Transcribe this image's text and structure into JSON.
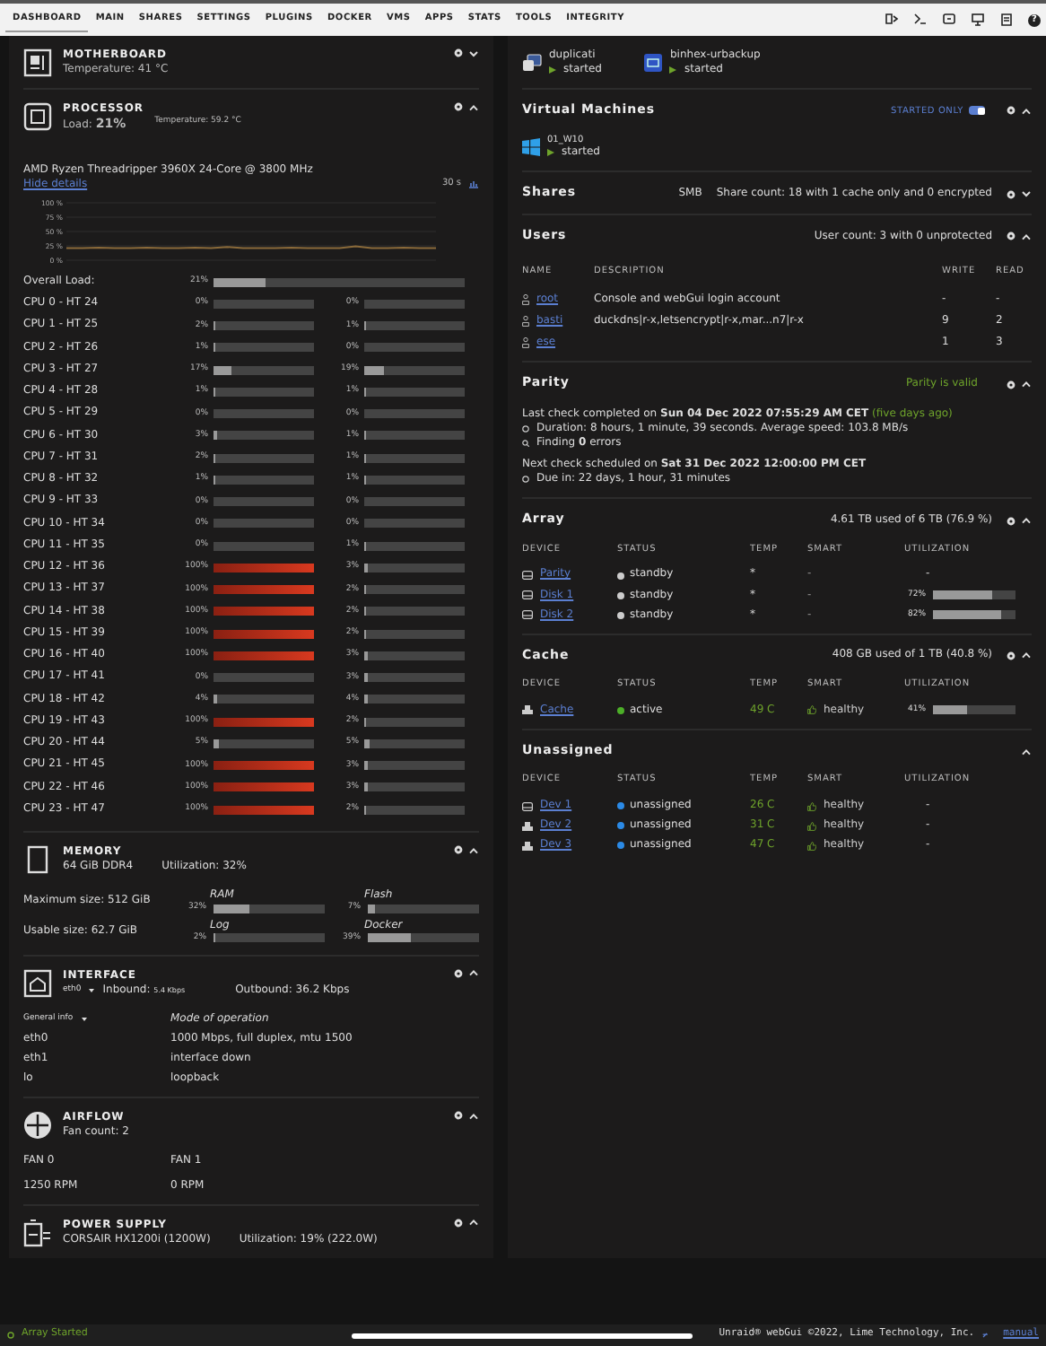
{
  "nav": {
    "tabs": [
      {
        "label": "DASHBOARD",
        "selected": true
      },
      {
        "label": "MAIN",
        "selected": false
      },
      {
        "label": "SHARES",
        "selected": false
      },
      {
        "label": "SETTINGS",
        "selected": false
      },
      {
        "label": "PLUGINS",
        "selected": false
      },
      {
        "label": "DOCKER",
        "selected": false
      },
      {
        "label": "VMS",
        "selected": false
      },
      {
        "label": "APPS",
        "selected": false
      },
      {
        "label": "STATS",
        "selected": false
      },
      {
        "label": "TOOLS",
        "selected": false
      },
      {
        "label": "INTEGRITY",
        "selected": false
      }
    ],
    "help": "?"
  },
  "motherboard": {
    "title": "MOTHERBOARD",
    "temperature": "Temperature: 41 °C",
    "expanded": false
  },
  "processor": {
    "title": "PROCESSOR",
    "load_label": "Load:",
    "load": "21%",
    "temperature": "Temperature: 59.2 °C",
    "expanded": true,
    "cpu_name": "AMD Ryzen Threadripper 3960X 24-Core @ 3800 MHz",
    "details_link": "Hide details",
    "interval": "30 s",
    "chart_data": {
      "type": "line",
      "ylim": [
        0,
        100
      ],
      "yticks": [
        {
          "value": 100,
          "label": "100 %"
        },
        {
          "value": 75,
          "label": "75 %"
        },
        {
          "value": 50,
          "label": "50 %"
        },
        {
          "value": 25,
          "label": "25 %"
        },
        {
          "value": 0,
          "label": "0 %"
        }
      ],
      "grid": true,
      "series": [
        {
          "color": "#8a6a3a",
          "values": [
            21,
            21,
            22,
            21,
            21,
            22,
            21,
            21,
            22,
            21,
            23,
            21,
            21,
            21,
            22,
            21,
            21,
            21,
            24,
            21,
            21,
            22,
            21,
            21
          ]
        }
      ]
    },
    "overall": {
      "label": "Overall Load:",
      "reading": "21%",
      "level": 0.21
    },
    "cpus": [
      {
        "label": "CPU 0 - HT 24",
        "a": {
          "reading": "0%",
          "level": 0
        },
        "b": {
          "reading": "0%",
          "level": 0
        }
      },
      {
        "label": "CPU 1 - HT 25",
        "a": {
          "reading": "2%",
          "level": 0.02
        },
        "b": {
          "reading": "1%",
          "level": 0.01
        }
      },
      {
        "label": "CPU 2 - HT 26",
        "a": {
          "reading": "1%",
          "level": 0.01
        },
        "b": {
          "reading": "0%",
          "level": 0
        }
      },
      {
        "label": "CPU 3 - HT 27",
        "a": {
          "reading": "17%",
          "level": 0.17
        },
        "b": {
          "reading": "19%",
          "level": 0.19
        }
      },
      {
        "label": "CPU 4 - HT 28",
        "a": {
          "reading": "1%",
          "level": 0.01
        },
        "b": {
          "reading": "1%",
          "level": 0.01
        }
      },
      {
        "label": "CPU 5 - HT 29",
        "a": {
          "reading": "0%",
          "level": 0
        },
        "b": {
          "reading": "0%",
          "level": 0
        }
      },
      {
        "label": "CPU 6 - HT 30",
        "a": {
          "reading": "3%",
          "level": 0.03
        },
        "b": {
          "reading": "1%",
          "level": 0.01
        }
      },
      {
        "label": "CPU 7 - HT 31",
        "a": {
          "reading": "2%",
          "level": 0.02
        },
        "b": {
          "reading": "1%",
          "level": 0.01
        }
      },
      {
        "label": "CPU 8 - HT 32",
        "a": {
          "reading": "1%",
          "level": 0.01
        },
        "b": {
          "reading": "1%",
          "level": 0.01
        }
      },
      {
        "label": "CPU 9 - HT 33",
        "a": {
          "reading": "0%",
          "level": 0
        },
        "b": {
          "reading": "0%",
          "level": 0
        }
      },
      {
        "label": "CPU 10 - HT 34",
        "a": {
          "reading": "0%",
          "level": 0
        },
        "b": {
          "reading": "0%",
          "level": 0
        }
      },
      {
        "label": "CPU 11 - HT 35",
        "a": {
          "reading": "0%",
          "level": 0
        },
        "b": {
          "reading": "1%",
          "level": 0.01
        }
      },
      {
        "label": "CPU 12 - HT 36",
        "a": {
          "reading": "100%",
          "level": 1
        },
        "b": {
          "reading": "3%",
          "level": 0.03
        }
      },
      {
        "label": "CPU 13 - HT 37",
        "a": {
          "reading": "100%",
          "level": 1
        },
        "b": {
          "reading": "2%",
          "level": 0.02
        }
      },
      {
        "label": "CPU 14 - HT 38",
        "a": {
          "reading": "100%",
          "level": 1
        },
        "b": {
          "reading": "2%",
          "level": 0.02
        }
      },
      {
        "label": "CPU 15 - HT 39",
        "a": {
          "reading": "100%",
          "level": 1
        },
        "b": {
          "reading": "2%",
          "level": 0.02
        }
      },
      {
        "label": "CPU 16 - HT 40",
        "a": {
          "reading": "100%",
          "level": 1
        },
        "b": {
          "reading": "3%",
          "level": 0.03
        }
      },
      {
        "label": "CPU 17 - HT 41",
        "a": {
          "reading": "0%",
          "level": 0
        },
        "b": {
          "reading": "3%",
          "level": 0.03
        }
      },
      {
        "label": "CPU 18 - HT 42",
        "a": {
          "reading": "4%",
          "level": 0.04
        },
        "b": {
          "reading": "4%",
          "level": 0.04
        }
      },
      {
        "label": "CPU 19 - HT 43",
        "a": {
          "reading": "100%",
          "level": 1
        },
        "b": {
          "reading": "2%",
          "level": 0.02
        }
      },
      {
        "label": "CPU 20 - HT 44",
        "a": {
          "reading": "5%",
          "level": 0.05
        },
        "b": {
          "reading": "5%",
          "level": 0.05
        }
      },
      {
        "label": "CPU 21 - HT 45",
        "a": {
          "reading": "100%",
          "level": 1
        },
        "b": {
          "reading": "3%",
          "level": 0.03
        }
      },
      {
        "label": "CPU 22 - HT 46",
        "a": {
          "reading": "100%",
          "level": 1
        },
        "b": {
          "reading": "3%",
          "level": 0.03
        }
      },
      {
        "label": "CPU 23 - HT 47",
        "a": {
          "reading": "100%",
          "level": 1
        },
        "b": {
          "reading": "2%",
          "level": 0.02
        }
      }
    ]
  },
  "memory": {
    "title": "MEMORY",
    "details": "64 GiB DDR4",
    "utilization": "Utilization: 32%",
    "expanded": true,
    "sizes": [
      "Maximum size: 512 GiB",
      "Usable size: 62.7 GiB"
    ],
    "bars": [
      {
        "name": "RAM",
        "reading": "32%",
        "level": 0.32
      },
      {
        "name": "Flash",
        "reading": "7%",
        "level": 0.07
      },
      {
        "name": "Log",
        "reading": "2%",
        "level": 0.02
      },
      {
        "name": "Docker",
        "reading": "39%",
        "level": 0.39
      }
    ]
  },
  "interface": {
    "title": "INTERFACE",
    "expanded": true,
    "port": "eth0",
    "inbound_label": "Inbound:",
    "inbound": "5.4 Kbps",
    "outbound": "Outbound: 36.2 Kbps",
    "info_select": "General info",
    "heading": "Mode of operation",
    "rows": [
      {
        "name": "eth0",
        "mode": "1000 Mbps, full duplex, mtu 1500"
      },
      {
        "name": "eth1",
        "mode": "interface down"
      },
      {
        "name": "lo",
        "mode": "loopback"
      }
    ]
  },
  "airflow": {
    "title": "AIRFLOW",
    "expanded": true,
    "subtitle": "Fan count: 2",
    "fans": [
      {
        "name": "FAN 0",
        "speed": "1250 RPM"
      },
      {
        "name": "FAN 1",
        "speed": "0 RPM"
      }
    ]
  },
  "power": {
    "title": "POWER SUPPLY",
    "expanded": true,
    "model": "CORSAIR HX1200i (1200W)",
    "utilization": "Utilization: 19% (222.0W)"
  },
  "docker": [
    {
      "name": "duplicati",
      "status": "started"
    },
    {
      "name": "binhex-urbackup",
      "status": "started"
    }
  ],
  "vms": {
    "title": "Virtual Machines",
    "filter": "STARTED ONLY",
    "filter_on": true,
    "expanded": true,
    "items": [
      {
        "name": "01_W10",
        "status": "started"
      }
    ]
  },
  "shares": {
    "title": "Shares",
    "protocol": "SMB",
    "summary": "Share count: 18 with 1 cache only and 0 encrypted",
    "expanded": false
  },
  "users": {
    "title": "Users",
    "summary": "User count: 3 with 0 unprotected",
    "expanded": true,
    "columns": [
      "NAME",
      "DESCRIPTION",
      "WRITE",
      "READ"
    ],
    "rows": [
      {
        "name": "root",
        "description": "Console and webGui login account",
        "write": "-",
        "read": "-"
      },
      {
        "name": "basti",
        "description": "duckdns|r-x,letsencrypt|r-x,mar...n7|r-x",
        "write": "9",
        "read": "2"
      },
      {
        "name": "ese",
        "description": "",
        "write": "1",
        "read": "3"
      }
    ]
  },
  "parity": {
    "title": "Parity",
    "status": "Parity is valid",
    "expanded": true,
    "last": "Last check completed on **Sun 04 Dec 2022 07:55:29 AM CET**",
    "ago": "(five days ago)",
    "duration": "Duration: 8 hours, 1 minute, 39 seconds. Average speed: 103.8 MB/s",
    "finding": "Finding **0** errors",
    "next": "Next check scheduled on **Sat 31 Dec 2022 12:00:00 PM CET**",
    "due": "Due in: 22 days, 1 hour, 31 minutes"
  },
  "disks": [
    {
      "title": "Array",
      "summary": "4.61 TB used of 6 TB (76.9 %)",
      "settings": true,
      "expanded": true,
      "columns": [
        "DEVICE",
        "STATUS",
        "TEMP",
        "SMART",
        "UTILIZATION"
      ],
      "rows": [
        {
          "device": "Parity",
          "kind": "hdd",
          "status": "standby",
          "color": "#cccccc",
          "temp": "*",
          "temp_ok": false,
          "smart": "-",
          "smart_ok": false,
          "utilization": "-"
        },
        {
          "device": "Disk 1",
          "kind": "hdd",
          "status": "standby",
          "color": "#cccccc",
          "temp": "*",
          "temp_ok": false,
          "smart": "-",
          "smart_ok": false,
          "utilization": "72%",
          "level": 0.72
        },
        {
          "device": "Disk 2",
          "kind": "hdd",
          "status": "standby",
          "color": "#cccccc",
          "temp": "*",
          "temp_ok": false,
          "smart": "-",
          "smart_ok": false,
          "utilization": "82%",
          "level": 0.82
        }
      ]
    },
    {
      "title": "Cache",
      "summary": "408 GB used of 1 TB (40.8 %)",
      "settings": true,
      "expanded": true,
      "columns": [
        "DEVICE",
        "STATUS",
        "TEMP",
        "SMART",
        "UTILIZATION"
      ],
      "rows": [
        {
          "device": "Cache",
          "kind": "ssd",
          "status": "active",
          "color": "#4caf28",
          "temp": "49 C",
          "temp_ok": true,
          "smart": "healthy",
          "smart_ok": true,
          "utilization": "41%",
          "level": 0.41
        }
      ]
    },
    {
      "title": "Unassigned",
      "settings": false,
      "expanded": true,
      "columns": [
        "DEVICE",
        "STATUS",
        "TEMP",
        "SMART",
        "UTILIZATION"
      ],
      "rows": [
        {
          "device": "Dev 1",
          "kind": "hdd",
          "status": "unassigned",
          "color": "#2b8ae6",
          "temp": "26 C",
          "temp_ok": true,
          "smart": "healthy",
          "smart_ok": true,
          "utilization": "-"
        },
        {
          "device": "Dev 2",
          "kind": "ssd",
          "status": "unassigned",
          "color": "#2b8ae6",
          "temp": "31 C",
          "temp_ok": true,
          "smart": "healthy",
          "smart_ok": true,
          "utilization": "-"
        },
        {
          "device": "Dev 3",
          "kind": "ssd",
          "status": "unassigned",
          "color": "#2b8ae6",
          "temp": "47 C",
          "temp_ok": true,
          "smart": "healthy",
          "smart_ok": true,
          "utilization": "-"
        }
      ]
    }
  ],
  "footer": {
    "status": "Array Started",
    "credits": "Unraid® webGui ©2022, Lime Technology, Inc.",
    "manual": "manual"
  }
}
